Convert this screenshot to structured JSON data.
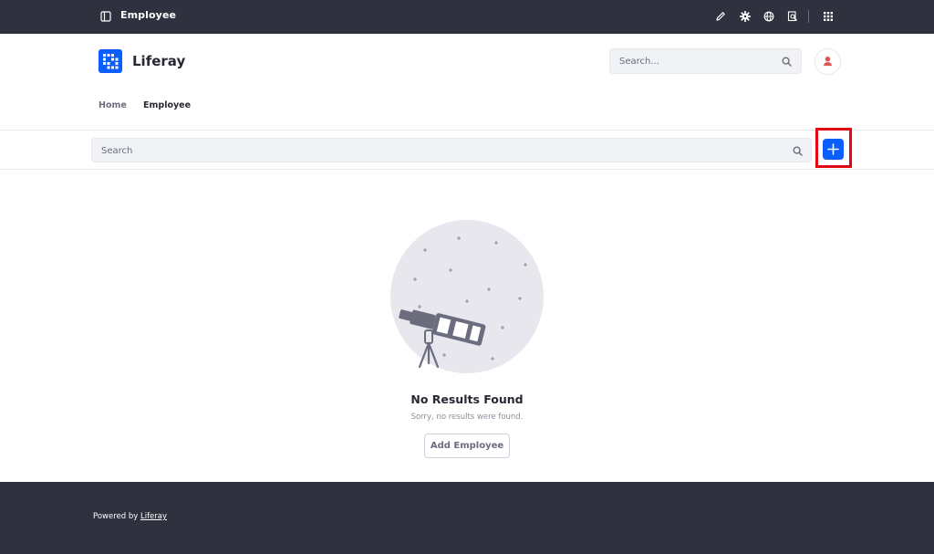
{
  "control_menu": {
    "title": "Employee",
    "icons": [
      "sidebar-toggle-icon",
      "pencil-icon",
      "gear-icon",
      "globe-icon",
      "simulation-icon",
      "apps-grid-icon"
    ]
  },
  "header": {
    "site_name": "Liferay",
    "search_placeholder": "Search...",
    "nav": [
      "Home",
      "Employee"
    ]
  },
  "management_bar": {
    "search_placeholder": "Search",
    "add_button_highlight_color": "#e30613"
  },
  "empty_state": {
    "title": "No Results Found",
    "description": "Sorry, no results were found.",
    "button_label": "Add Employee"
  },
  "footer": {
    "powered_by": "Powered by",
    "link": "Liferay"
  },
  "colors": {
    "primary": "#0b5fff",
    "dark_bar": "#30313f"
  }
}
